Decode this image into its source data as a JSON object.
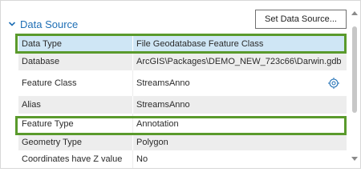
{
  "section": {
    "title": "Data Source",
    "set_button_label": "Set Data Source..."
  },
  "rows": [
    {
      "label": "Data Type",
      "value": "File Geodatabase Feature Class"
    },
    {
      "label": "Database",
      "value": "ArcGIS\\Packages\\DEMO_NEW_723c66\\Darwin.gdb"
    },
    {
      "label": "Feature Class",
      "value": "StreamsAnno"
    },
    {
      "label": "Alias",
      "value": "StreamsAnno"
    },
    {
      "label": "Feature Type",
      "value": "Annotation"
    },
    {
      "label": "Geometry Type",
      "value": "Polygon"
    },
    {
      "label": "Coordinates have Z value",
      "value": "No"
    }
  ],
  "icons": {
    "section_toggle": "chevron-down-icon",
    "feature_class_action": "locate-crosshair-icon",
    "scroll_up": "arrow-up-icon",
    "scroll_down": "arrow-down-icon"
  },
  "colors": {
    "accent": "#1f6fb5",
    "highlight_outline": "#5a9a2c",
    "selected_row": "#cfe6f5",
    "alt_row": "#ededed"
  }
}
